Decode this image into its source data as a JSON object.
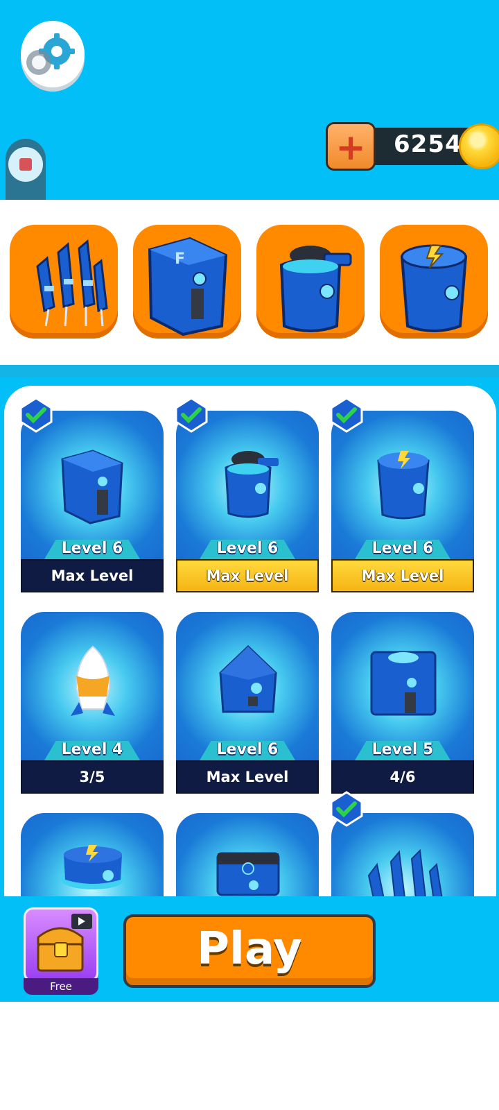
{
  "currency": {
    "plus_icon": "plus-icon",
    "coins": "6254",
    "coin_icon": "gold-coin-icon"
  },
  "tower_strip": [
    {
      "name": "rocket-launcher-icon"
    },
    {
      "name": "box-tower-icon"
    },
    {
      "name": "cannon-tower-icon"
    },
    {
      "name": "lightning-tower-icon"
    }
  ],
  "cards": [
    {
      "level": "Level 6",
      "status": "Max Level",
      "checked": true,
      "style": "dark"
    },
    {
      "level": "Level 6",
      "status": "Max Level",
      "checked": true,
      "style": "gold"
    },
    {
      "level": "Level 6",
      "status": "Max Level",
      "checked": true,
      "style": "gold"
    },
    {
      "level": "Level 4",
      "status": "3/5",
      "checked": false,
      "style": "dark"
    },
    {
      "level": "Level 6",
      "status": "Max Level",
      "checked": false,
      "style": "dark"
    },
    {
      "level": "Level 5",
      "status": "4/6",
      "checked": false,
      "style": "dark"
    },
    {
      "checked": false
    },
    {
      "checked": false
    },
    {
      "checked": true
    }
  ],
  "bottom": {
    "chest_label": "Free",
    "play_label": "Play"
  },
  "colors": {
    "sky": "#02bff7",
    "orange": "#ff8a00",
    "card_blue": "#1660cc",
    "status_dark": "#0f1b43",
    "status_gold": "#f5b413"
  }
}
